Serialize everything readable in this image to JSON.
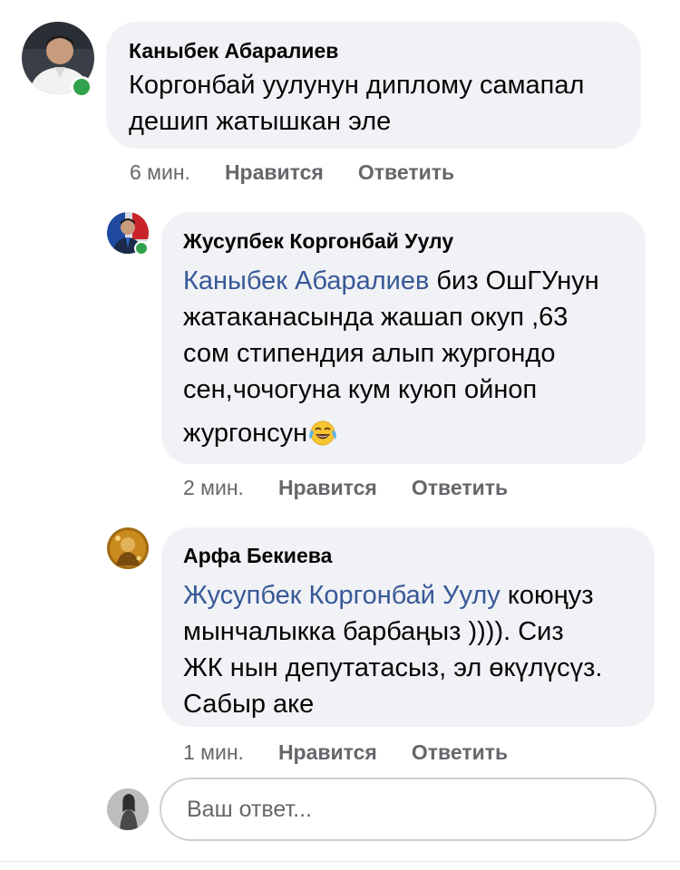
{
  "comments": [
    {
      "author": "Каныбек Абаралиев",
      "lines": [
        "Коргонбай уулунун диплому самапал",
        "дешип жатышкан эле"
      ],
      "time": "6 мин.",
      "like": "Нравится",
      "reply": "Ответить"
    },
    {
      "author": "Жусупбек Коргонбай Уулу",
      "mention": "Каныбек Абаралиев",
      "line1_rest": " биз ОшГУнун",
      "lines": [
        "жатаканасында жашап окуп ,63",
        "сом стипендия алып жургондо",
        "сен,чочогуна кум куюп ойноп"
      ],
      "last_line": "жургонсун",
      "emoji": "face-with-tears-of-joy",
      "time": "2 мин.",
      "like": "Нравится",
      "reply": "Ответить"
    },
    {
      "author": "Арфа Бекиева",
      "mention": "Жусупбек Коргонбай Уулу",
      "line1_rest": " коюңуз",
      "lines": [
        "мынчалыкка барбаңыз )))). Сиз",
        "ЖК нын депутатасыз, эл өкүлүсүз.",
        "Сабыр аке"
      ],
      "time": "1 мин.",
      "like": "Нравится",
      "reply": "Ответить"
    }
  ],
  "reply_input": {
    "placeholder": "Ваш ответ..."
  },
  "colors": {
    "bubble": "#f0f2f5",
    "mention": "#385898",
    "meta": "#65676b",
    "online": "#31a24c"
  }
}
